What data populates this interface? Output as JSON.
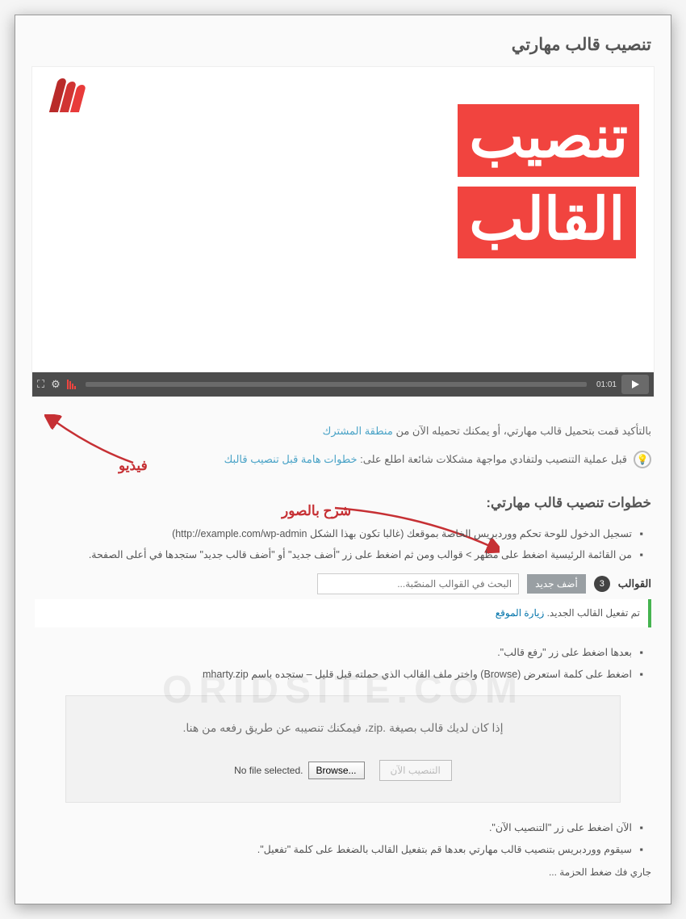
{
  "title": "تنصيب قالب مهارتي",
  "video": {
    "title_line1": "تنصيب",
    "title_line2": "القالب",
    "timestamp": "01:01"
  },
  "annotations": {
    "video_label": "فيديو",
    "images_label": "شرح بالصور"
  },
  "intro": {
    "text_before": "بالتأكيد قمت بتحميل قالب مهارتي، أو يمكنك تحميله الآن من ",
    "link": "منطقة المشترك"
  },
  "tip": {
    "text_before": "قبل عملية التنصيب ولتفادي مواجهة مشكلات شائعة اطلع على: ",
    "link": "خطوات هامة قبل تنصيب قالبك"
  },
  "steps_heading": "خطوات تنصيب قالب مهارتي:",
  "steps1": [
    "تسجيل الدخول للوحة تحكم ووردبريس الخاصة بموقعك (غالبا تكون بهذا الشكل http://example.com/wp-admin)",
    "من القائمة الرئيسية اضغط على مظهر > قوالب ومن ثم اضغط على زر \"أضف جديد\" أو \"أضف قالب جديد\" ستجدها في أعلى الصفحة."
  ],
  "themes_bar": {
    "label": "القوالب",
    "count": "3",
    "add_new": "أضف جديد",
    "search_placeholder": "البحث في القوالب المنصّبة..."
  },
  "notice": {
    "text": "تم تفعيل القالب الجديد. ",
    "link": "زيارة الموقع"
  },
  "watermark": "ORIDSITE.COM",
  "steps2": [
    "بعدها اضغط على زر \"رفع قالب\".",
    "اضغط على كلمة استعرض (Browse) واختر ملف القالب الذي حملته قبل قليل – ستجده باسم  mharty.zip"
  ],
  "upload": {
    "heading": "إذا كان لديك قالب بصيغة .zip، فيمكنك تنصيبه عن طريق رفعه من هنا.",
    "install_btn": "التنصيب الآن",
    "no_file": "No file selected.",
    "browse": "Browse..."
  },
  "steps3": [
    "الآن اضغط على زر \"التنصيب الآن\".",
    "سيقوم ووردبريس بتنصيب قالب مهارتي بعدها قم بتفعيل القالب بالضغط على كلمة \"تفعيل\"."
  ],
  "status_line": "جاري فك ضغط الحزمة ..."
}
